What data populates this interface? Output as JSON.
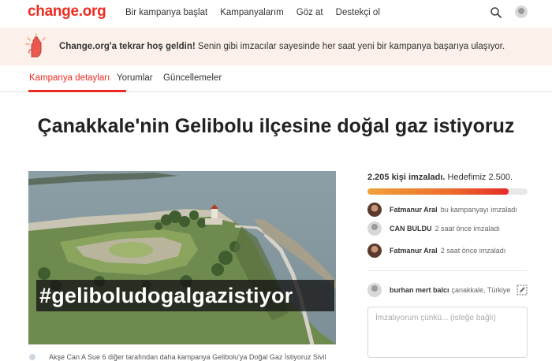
{
  "brand": {
    "logo_text": "change.org",
    "accent": "#ec2c22"
  },
  "nav": {
    "links": [
      "Bir kampanya başlat",
      "Kampanyalarım",
      "Göz at",
      "Destekçi ol"
    ],
    "search_icon": "search-icon",
    "avatar_icon": "user-avatar-icon"
  },
  "banner": {
    "icon": "raised-hand-icon",
    "bold_text": "Change.org'a tekrar hoş geldin!",
    "text": " Senin gibi imzacılar sayesinde her saat yeni bir kampanya başarıya ulaşıyor."
  },
  "tabs": [
    {
      "label": "Kampanya detayları",
      "active": true
    },
    {
      "label": "Yorumlar",
      "active": false
    },
    {
      "label": "Güncellemeler",
      "active": false
    }
  ],
  "petition": {
    "title": "Çanakkale'nin Gelibolu ilçesine doğal gaz istiyoruz",
    "image_caption": "#geliboludogalgazistiyor",
    "bottom_text": "Akşe Can A Sue 6 diğer tarafından daha kampanya Gelibolu'ya Doğal Gaz İstiyoruz Sivil"
  },
  "signatures": {
    "count_bold": "2.205 kişi imzaladı.",
    "goal_text": " Hedefimiz 2.500.",
    "progress_fraction": 0.882,
    "recent": [
      {
        "name": "Fatmanur Aral",
        "action": "bu kampanyayı imzaladı",
        "avatar": "photo"
      },
      {
        "name": "CAN BULDU",
        "action": "2 saat önce imzaladı",
        "avatar": "default"
      },
      {
        "name": "Fatmanur Aral",
        "action": "2 saat önce imzaladı",
        "avatar": "photo"
      }
    ]
  },
  "signer_form": {
    "name": "burhan mert balcı",
    "location": "çanakkale, Türkiye",
    "edit_icon": "edit-pencil-icon",
    "comment_placeholder": "İmzalıyorum çünkü... (isteğe bağlı)"
  }
}
